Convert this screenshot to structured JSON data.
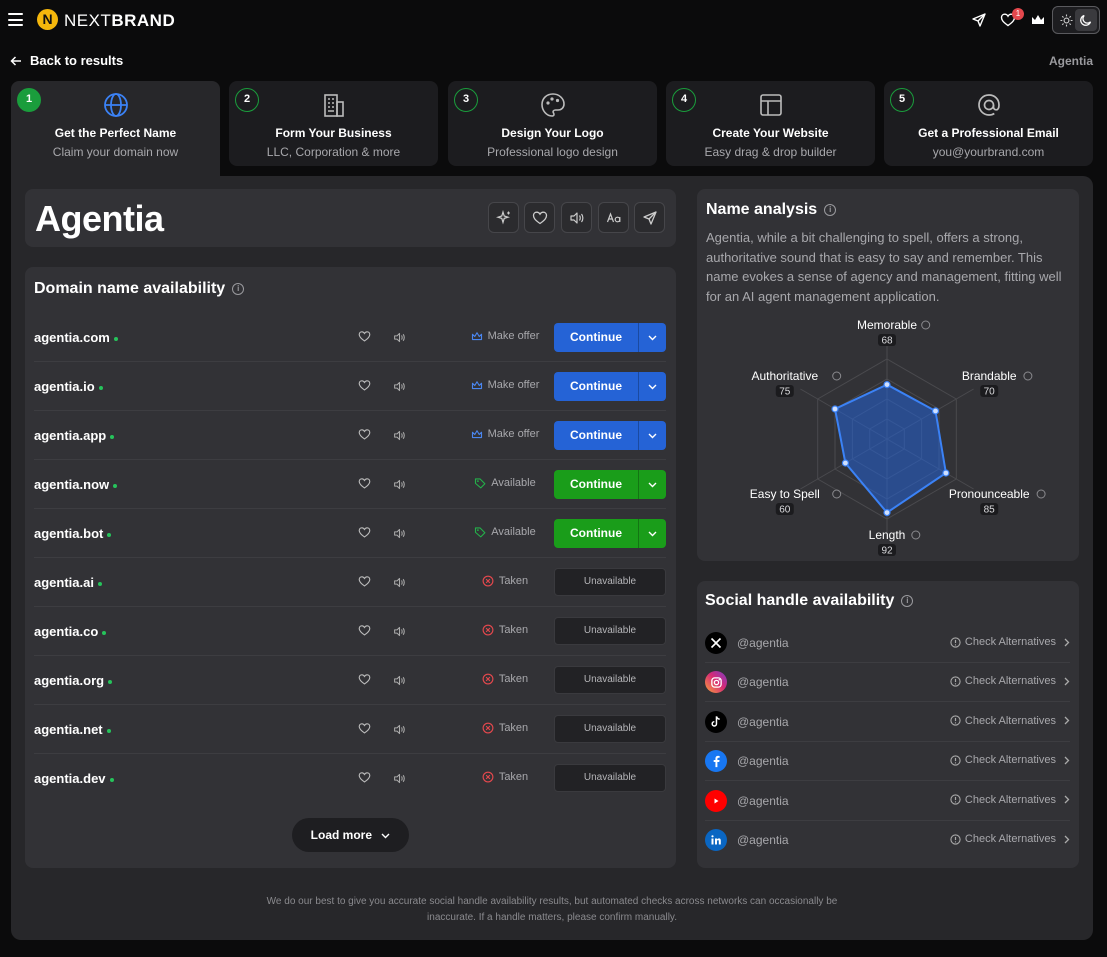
{
  "app": {
    "brand_light": "NEXT",
    "brand_bold": "BRAND",
    "logo_letter": "N",
    "notifications": "1"
  },
  "nav": {
    "back_label": "Back to results",
    "current_name": "Agentia"
  },
  "steps": [
    {
      "num": "1",
      "title": "Get the Perfect Name",
      "subtitle": "Claim your domain now",
      "icon": "globe-icon"
    },
    {
      "num": "2",
      "title": "Form Your Business",
      "subtitle": "LLC, Corporation & more",
      "icon": "building-icon"
    },
    {
      "num": "3",
      "title": "Design Your Logo",
      "subtitle": "Professional logo design",
      "icon": "palette-icon"
    },
    {
      "num": "4",
      "title": "Create Your Website",
      "subtitle": "Easy drag & drop builder",
      "icon": "layout-icon"
    },
    {
      "num": "5",
      "title": "Get a Professional Email",
      "subtitle": "you@yourbrand.com",
      "icon": "at-icon"
    }
  ],
  "name": {
    "title": "Agentia"
  },
  "domains": {
    "title": "Domain name availability",
    "load_more": "Load more",
    "rows": [
      {
        "name": "agentia.com",
        "status": "Make offer",
        "kind": "offer",
        "action": "Continue"
      },
      {
        "name": "agentia.io",
        "status": "Make offer",
        "kind": "offer",
        "action": "Continue"
      },
      {
        "name": "agentia.app",
        "status": "Make offer",
        "kind": "offer",
        "action": "Continue"
      },
      {
        "name": "agentia.now",
        "status": "Available",
        "kind": "available",
        "action": "Continue"
      },
      {
        "name": "agentia.bot",
        "status": "Available",
        "kind": "available",
        "action": "Continue"
      },
      {
        "name": "agentia.ai",
        "status": "Taken",
        "kind": "taken",
        "action": "Unavailable"
      },
      {
        "name": "agentia.co",
        "status": "Taken",
        "kind": "taken",
        "action": "Unavailable"
      },
      {
        "name": "agentia.org",
        "status": "Taken",
        "kind": "taken",
        "action": "Unavailable"
      },
      {
        "name": "agentia.net",
        "status": "Taken",
        "kind": "taken",
        "action": "Unavailable"
      },
      {
        "name": "agentia.dev",
        "status": "Taken",
        "kind": "taken",
        "action": "Unavailable"
      }
    ]
  },
  "analysis": {
    "title": "Name analysis",
    "text": "Agentia, while a bit challenging to spell, offers a strong, authoritative sound that is easy to say and remember. This name evokes a sense of agency and management, fitting well for an AI agent management application.",
    "scores": [
      {
        "label": "Memorable",
        "value": 68
      },
      {
        "label": "Brandable",
        "value": 70
      },
      {
        "label": "Pronounceable",
        "value": 85
      },
      {
        "label": "Length",
        "value": 92
      },
      {
        "label": "Easy to Spell",
        "value": 60
      },
      {
        "label": "Authoritative",
        "value": 75
      }
    ]
  },
  "social": {
    "title": "Social handle availability",
    "check_label": "Check Alternatives",
    "rows": [
      {
        "network": "x-icon",
        "handle": "@agentia",
        "color": "#000000"
      },
      {
        "network": "instagram-icon",
        "handle": "@agentia",
        "color": "#d62976"
      },
      {
        "network": "tiktok-icon",
        "handle": "@agentia",
        "color": "#000000"
      },
      {
        "network": "facebook-icon",
        "handle": "@agentia",
        "color": "#1877f2"
      },
      {
        "network": "youtube-icon",
        "handle": "@agentia",
        "color": "#ff0000"
      },
      {
        "network": "linkedin-icon",
        "handle": "@agentia",
        "color": "#0a66c2"
      }
    ]
  },
  "footer": {
    "disclaimer": "We do our best to give you accurate social handle availability results, but automated checks across networks can occasionally be inaccurate. If a handle matters, please confirm manually."
  },
  "colors": {
    "accent_blue": "#2563d6",
    "accent_green": "#1a9d1a",
    "taken_red": "#e5484d",
    "step_green": "#1a9d3c"
  }
}
